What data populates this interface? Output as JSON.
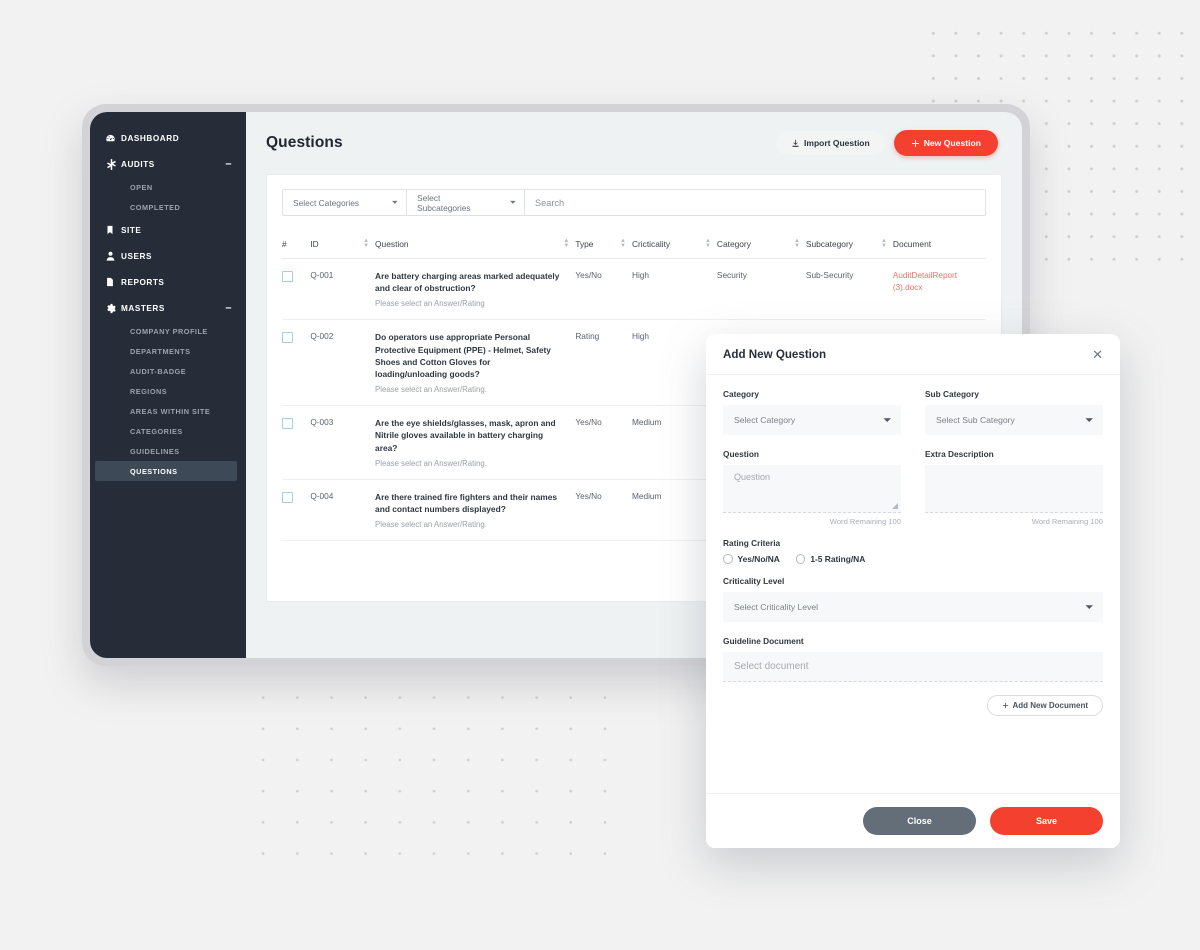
{
  "app": {
    "page_title": "Questions"
  },
  "sidebar": {
    "items": [
      {
        "label": "DASHBOARD",
        "icon": "dashboard-icon",
        "type": "item",
        "expandable": false
      },
      {
        "label": "AUDITS",
        "icon": "asterisk-icon",
        "type": "item",
        "expandable": true,
        "toggle": "–"
      },
      {
        "label": "OPEN",
        "type": "sub",
        "active": false
      },
      {
        "label": "COMPLETED",
        "type": "sub",
        "active": false
      },
      {
        "label": "SITE",
        "icon": "bookmark-icon",
        "type": "item",
        "expandable": false
      },
      {
        "label": "USERS",
        "icon": "user-icon",
        "type": "item",
        "expandable": false
      },
      {
        "label": "REPORTS",
        "icon": "file-icon",
        "type": "item",
        "expandable": false
      },
      {
        "label": "MASTERS",
        "icon": "gear-icon",
        "type": "item",
        "expandable": true,
        "toggle": "–"
      },
      {
        "label": "COMPANY PROFILE",
        "type": "sub",
        "active": false
      },
      {
        "label": "DEPARTMENTS",
        "type": "sub",
        "active": false
      },
      {
        "label": "AUDIT-BADGE",
        "type": "sub",
        "active": false
      },
      {
        "label": "REGIONS",
        "type": "sub",
        "active": false
      },
      {
        "label": "AREAS WITHIN SITE",
        "type": "sub",
        "active": false
      },
      {
        "label": "CATEGORIES",
        "type": "sub",
        "active": false
      },
      {
        "label": "GUIDELINES",
        "type": "sub",
        "active": false
      },
      {
        "label": "QUESTIONS",
        "type": "sub",
        "active": true
      }
    ]
  },
  "header": {
    "import_label": "Import Question",
    "new_label": "New Question",
    "import_icon": "download-icon",
    "new_icon": "plus-icon"
  },
  "filters": {
    "categories_label": "Select Categories",
    "subcategories_label": "Select Subcategories",
    "search_placeholder": "Search"
  },
  "table": {
    "columns": [
      {
        "label": "#",
        "sortable": false
      },
      {
        "label": "ID",
        "sortable": true
      },
      {
        "label": "Question",
        "sortable": true
      },
      {
        "label": "Type",
        "sortable": true
      },
      {
        "label": "Cricticality",
        "sortable": true
      },
      {
        "label": "Category",
        "sortable": true
      },
      {
        "label": "Subcategory",
        "sortable": true
      },
      {
        "label": "Document",
        "sortable": false
      }
    ],
    "rows": [
      {
        "id": "Q-001",
        "question": "Are battery charging areas marked adequately and clear of obstruction?",
        "hint": "Please select an Answer/Rating",
        "type": "Yes/No",
        "criticality": "High",
        "category": "Security",
        "subcategory": "Sub-Security",
        "document": "AuditDetailReport (3).docx"
      },
      {
        "id": "Q-002",
        "question": "Do operators use appropriate Personal Protective Equipment (PPE) - Helmet, Safety Shoes and Cotton Gloves for loading/unloading goods?",
        "hint": "Please select an Answer/Rating.",
        "type": "Rating",
        "criticality": "High",
        "category": "",
        "subcategory": "",
        "document": ""
      },
      {
        "id": "Q-003",
        "question": "Are the eye shields/glasses, mask, apron and Nitrile gloves available in battery charging area?",
        "hint": "Please select an Answer/Rating.",
        "type": "Yes/No",
        "criticality": "Medium",
        "category": "",
        "subcategory": "",
        "document": ""
      },
      {
        "id": "Q-004",
        "question": "Are there trained fire fighters and their names and contact numbers displayed?",
        "hint": "Please select an Answer/Rating.",
        "type": "Yes/No",
        "criticality": "Medium",
        "category": "",
        "subcategory": "",
        "document": ""
      }
    ]
  },
  "modal": {
    "title": "Add New Question",
    "close_icon": "close-icon",
    "category": {
      "label": "Category",
      "value": "Select Category"
    },
    "sub_category": {
      "label": "Sub Category",
      "value": "Select Sub Category"
    },
    "question": {
      "label": "Question",
      "placeholder": "Question",
      "word_remaining": "Word Remaining 100"
    },
    "extra_description": {
      "label": "Extra Description",
      "placeholder": "",
      "word_remaining": "Word Remaining 100"
    },
    "rating_criteria": {
      "label": "Rating Criteria",
      "options": [
        {
          "label": "Yes/No/NA",
          "selected": false
        },
        {
          "label": "1-5 Rating/NA",
          "selected": false
        }
      ]
    },
    "criticality_level": {
      "label": "Criticality Level",
      "value": "Select Criticality Level"
    },
    "guideline_document": {
      "label": "Guideline Document",
      "value": "Select document"
    },
    "add_document_label": "Add New Document",
    "close_label": "Close",
    "save_label": "Save"
  },
  "colors": {
    "accent_red": "#f4402f",
    "sidebar_bg": "#262d38",
    "active_item_bg": "#3d4956",
    "close_gray": "#646e79",
    "doc_link": "#f4716a"
  }
}
